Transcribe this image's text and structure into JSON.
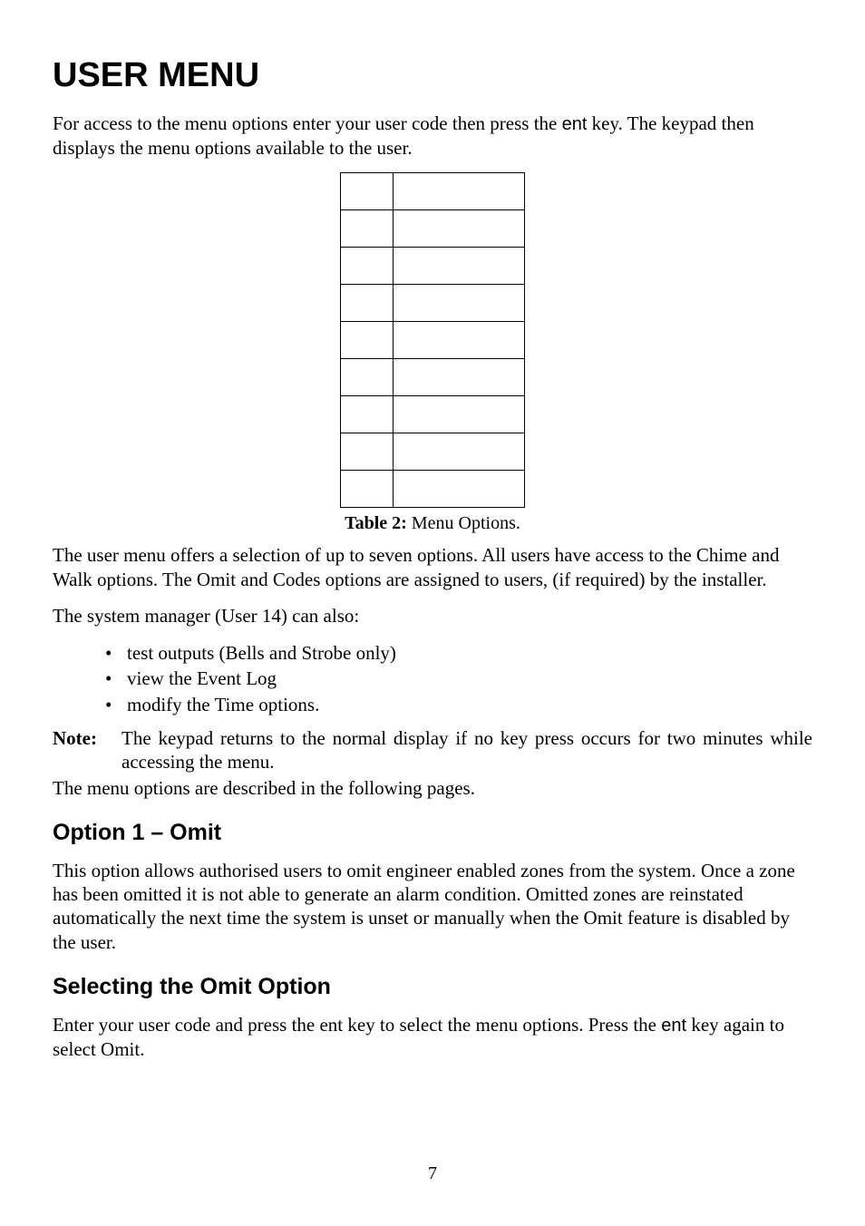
{
  "title": "USER MENU",
  "intro_a": "For access to the menu options enter your user code then press the ",
  "intro_key": "ent",
  "intro_b": " key. The keypad then displays the menu options available to the user.",
  "table": {
    "rows": 9
  },
  "table_caption_bold": "Table 2:",
  "table_caption_rest": " Menu Options.",
  "para2": "The user menu offers a selection of up to seven options. All users have access to the Chime and Walk options. The Omit and Codes options are assigned to users, (if required) by the installer.",
  "para3": "The system manager (User 14) can also:",
  "bullets": [
    "test outputs (Bells and Strobe only)",
    "view the Event Log",
    "modify the Time options."
  ],
  "note_label": "Note:",
  "note_text": "The keypad returns to the normal display if no key press occurs for two minutes while accessing the menu.",
  "para4": "The menu options are described in the following pages.",
  "h2_omit": "Option 1 – Omit",
  "para_omit": "This option allows authorised users to omit engineer enabled zones from the system. Once a zone has been omitted it is not able to generate an alarm condition. Omitted zones are reinstated automatically the next time the system is unset or manually when the Omit feature is disabled by the user.",
  "h2_select": "Selecting the Omit Option",
  "para_select_a": "Enter your user code and press the ent key to select the menu options. Press the ",
  "para_select_key": "ent",
  "para_select_b": " key again to select Omit.",
  "page_number": "7"
}
